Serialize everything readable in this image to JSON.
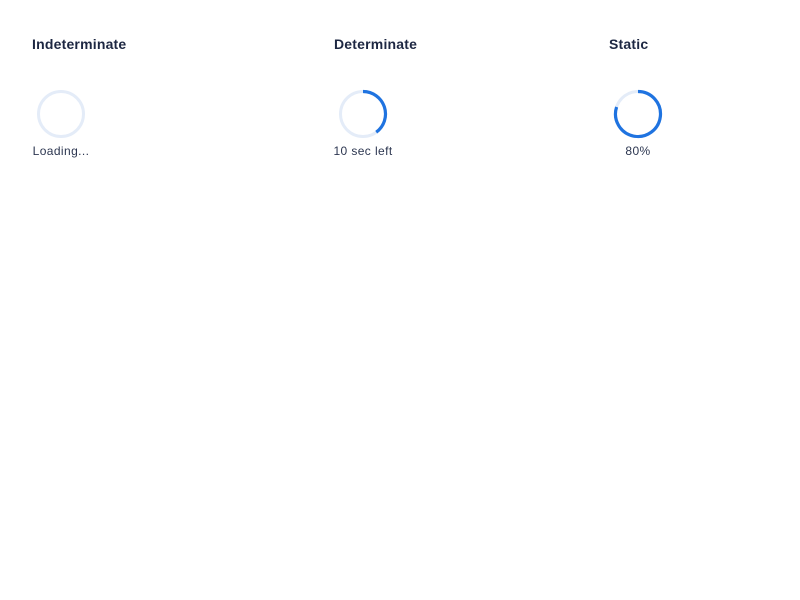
{
  "colors": {
    "accent": "#1f73e0",
    "track": "#e4ecf8",
    "text": "#1d2742"
  },
  "sections": [
    {
      "title": "Indeterminate",
      "caption": "Loading...",
      "progress": 0
    },
    {
      "title": "Determinate",
      "caption": "10 sec left",
      "progress": 0.4
    },
    {
      "title": "Static",
      "caption": "80%",
      "progress": 0.8
    }
  ]
}
